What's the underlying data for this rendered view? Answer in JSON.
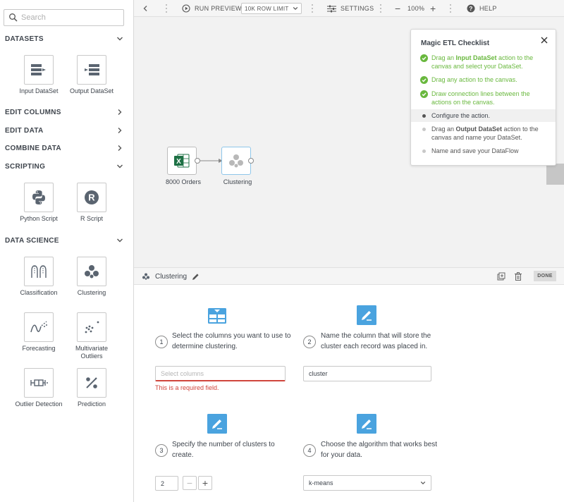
{
  "sidebar": {
    "search_placeholder": "Search",
    "categories": {
      "datasets": "DATASETS",
      "edit_columns": "EDIT COLUMNS",
      "edit_data": "EDIT DATA",
      "combine_data": "COMBINE DATA",
      "scripting": "SCRIPTING",
      "data_science": "DATA SCIENCE"
    },
    "tiles": {
      "input_dataset": "Input DataSet",
      "output_dataset": "Output DataSet",
      "python_script": "Python Script",
      "r_script": "R Script",
      "classification": "Classification",
      "clustering": "Clustering",
      "forecasting": "Forecasting",
      "multivariate_line1": "Multivariate",
      "multivariate_line2": "Outliers",
      "outlier_detection": "Outlier Detection",
      "prediction": "Prediction"
    }
  },
  "toolbar": {
    "run_preview": "RUN PREVIEW",
    "row_limit": "10K ROW LIMIT",
    "settings": "SETTINGS",
    "zoom": "100%",
    "help": "HELP"
  },
  "canvas": {
    "node_input": "8000 Orders",
    "node_cluster": "Clustering"
  },
  "checklist": {
    "title": "Magic ETL Checklist",
    "item1_pre": "Drag an ",
    "item1_bold": "Input DataSet",
    "item1_post": " action to the canvas and select your DataSet.",
    "item2": "Drag any action to the canvas.",
    "item3": "Draw connection lines between the actions on the canvas.",
    "item4": "Configure the action.",
    "item5_pre": "Drag an ",
    "item5_bold": "Output DataSet",
    "item5_post": " action to the canvas and name your DataSet.",
    "item6": "Name and save your DataFlow"
  },
  "panel": {
    "title": "Clustering",
    "done": "DONE",
    "step1_num": "1",
    "step1_text": "Select the columns you want to use to determine clustering.",
    "step1_placeholder": "Select columns",
    "step1_error": "This is a required field.",
    "step2_num": "2",
    "step2_text": "Name the column that will store the cluster each record was placed in.",
    "step2_value": "cluster",
    "step3_num": "3",
    "step3_text": "Specify the number of clusters to create.",
    "step3_value": "2",
    "step4_num": "4",
    "step4_text": "Choose the algorithm that works best for your data.",
    "step4_value": "k-means"
  },
  "colors": {
    "accent_blue": "#4aa3df",
    "success_green": "#69b83e",
    "error_red": "#d0453c",
    "excel_green": "#1e7145"
  },
  "icons": [
    "search-icon",
    "chevron-down-icon",
    "chevron-right-icon",
    "input-dataset-icon",
    "output-dataset-icon",
    "python-icon",
    "r-icon",
    "classification-icon",
    "clustering-icon",
    "forecasting-icon",
    "multivariate-outliers-icon",
    "outlier-detection-icon",
    "prediction-icon",
    "chevron-left-icon",
    "play-icon",
    "sliders-icon",
    "help-icon",
    "close-icon",
    "check-circle-icon",
    "excel-icon",
    "pencil-icon",
    "copy-icon",
    "trash-icon",
    "table-icon"
  ]
}
